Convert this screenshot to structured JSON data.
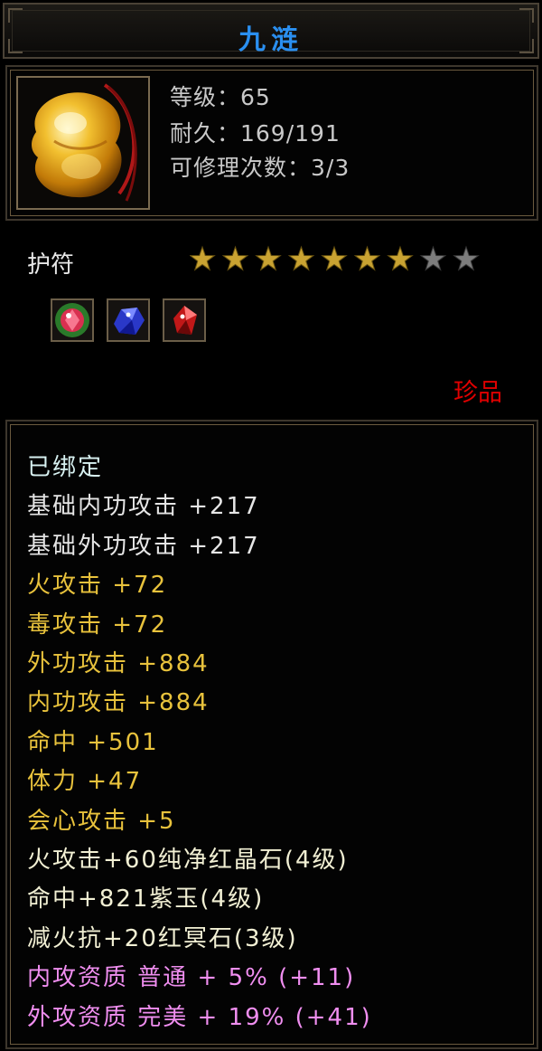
{
  "item": {
    "name": "九涟",
    "level_text": "等级：65",
    "durability_text": "耐久：169/191",
    "repair_text": "可修理次数：3/3",
    "type": "护符",
    "stars_total": 9,
    "stars_filled": 7,
    "rarity": "珍品",
    "icon": "yellow-jade-amulet-icon",
    "gems": [
      {
        "icon": "green-red-gem-icon",
        "color": "#2a8a2a"
      },
      {
        "icon": "blue-crystal-gem-icon",
        "color": "#2a3ad0"
      },
      {
        "icon": "red-crystal-gem-icon",
        "color": "#c01818"
      }
    ]
  },
  "attributes": [
    {
      "text": "已绑定",
      "color": "cyan"
    },
    {
      "text": "基础内功攻击 +217",
      "color": "white"
    },
    {
      "text": "基础外功攻击 +217",
      "color": "white"
    },
    {
      "text": "火攻击 +72",
      "color": "gold"
    },
    {
      "text": "毒攻击 +72",
      "color": "gold"
    },
    {
      "text": "外功攻击 +884",
      "color": "gold"
    },
    {
      "text": "内功攻击 +884",
      "color": "gold"
    },
    {
      "text": "命中 +501",
      "color": "gold"
    },
    {
      "text": "体力 +47",
      "color": "gold"
    },
    {
      "text": "会心攻击 +5",
      "color": "gold"
    },
    {
      "text": "火攻击+60纯净红晶石(4级)",
      "color": "cream"
    },
    {
      "text": "命中+821紫玉(4级)",
      "color": "cream"
    },
    {
      "text": "减火抗+20红冥石(3级)",
      "color": "cream"
    },
    {
      "text": "内攻资质 普通 + 5% (+11)",
      "color": "pink"
    },
    {
      "text": "外攻资质 完美 + 19% (+41)",
      "color": "pink"
    }
  ],
  "colors": {
    "title": "#2a8ff0",
    "star_filled": "#c9a332",
    "star_empty": "#7d7d7d",
    "rarity": "#e00000"
  }
}
